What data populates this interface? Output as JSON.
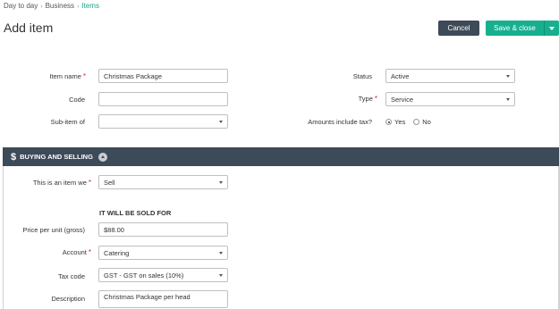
{
  "breadcrumb": [
    "Day to day",
    "Business",
    "Items"
  ],
  "page_title": "Add item",
  "toolbar": {
    "cancel_label": "Cancel",
    "save_label": "Save & close"
  },
  "form": {
    "item_name": {
      "label": "Item name",
      "value": "Christmas Package"
    },
    "code": {
      "label": "Code",
      "value": ""
    },
    "sub_item_of": {
      "label": "Sub-item of",
      "value": ""
    },
    "status": {
      "label": "Status",
      "value": "Active"
    },
    "type": {
      "label": "Type",
      "value": "Service"
    },
    "amounts_include_tax": {
      "label": "Amounts include tax?",
      "options": [
        "Yes",
        "No"
      ],
      "selected": "Yes"
    }
  },
  "section": {
    "title": "BUYING AND SELLING",
    "icon": "dollar-icon",
    "item_we": {
      "label": "This is an item we",
      "value": "Sell"
    },
    "sold_for_heading": "IT WILL BE SOLD FOR",
    "price": {
      "label": "Price per unit (gross)",
      "value": "$88.00"
    },
    "account": {
      "label": "Account",
      "value": "Catering"
    },
    "tax_code": {
      "label": "Tax code",
      "value": "GST - GST on sales (10%)"
    },
    "description": {
      "label": "Description",
      "value": "Christmas Package per head"
    }
  },
  "colors": {
    "accent": "#17b08f",
    "dark": "#3d4a57",
    "required": "#d9263a"
  }
}
